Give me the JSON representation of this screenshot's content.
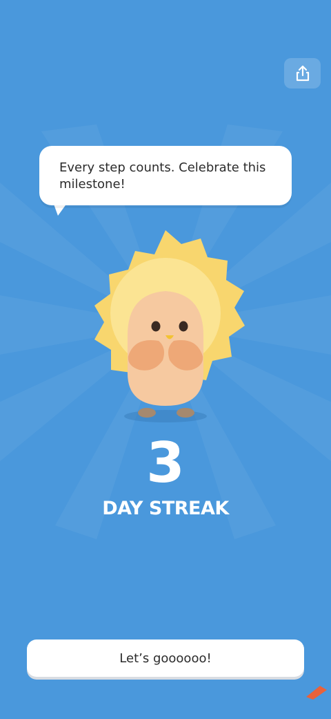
{
  "header": {
    "share_icon": "share-icon"
  },
  "bubble": {
    "message": "Every step counts. Celebrate this milestone!"
  },
  "mascot": {
    "icon": "sun-mascot-illustration"
  },
  "streak": {
    "count": "3",
    "label": "DAY STREAK"
  },
  "cta": {
    "label": "Let’s goooooo!"
  },
  "colors": {
    "background": "#4A98DC",
    "sun": "#F8D66E",
    "body": "#F6C9A0",
    "white": "#FFFFFF",
    "accent_corner": "#E8623A"
  }
}
